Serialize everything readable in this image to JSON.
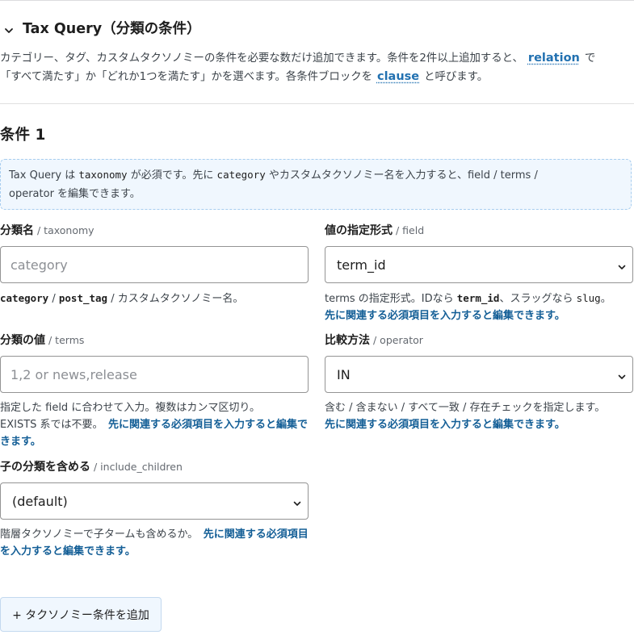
{
  "section": {
    "title": "Tax Query（分類の条件）",
    "intro": {
      "line1_before": "カテゴリー、タグ、カスタムタクソノミーの条件を必要な数だけ追加できます。条件を2件以上追加すると、",
      "relation_link": "relation",
      "line1_after": "で",
      "line2_before": "「すべて満たす」か「どれか1つを満たす」かを選べます。各条件ブロックを",
      "clause_link": "clause",
      "line2_after": "と呼びます。"
    }
  },
  "clause": {
    "title": "条件 1",
    "notice": {
      "p1": "Tax Query は ",
      "code": "taxonomy",
      "p2": " が必須です。先に ",
      "code2": "category",
      "p3": " やカスタムタクソノミー名を入力すると、field / terms /",
      "p4": "operator を編集できます。"
    },
    "fields": {
      "taxonomy": {
        "label": "分類名",
        "sub": "/ taxonomy",
        "placeholder": "category",
        "help_c1": "category",
        "help_s1": " / ",
        "help_c2": "post_tag",
        "help_t": " / カスタムタクソノミー名。"
      },
      "field": {
        "label": "値の指定形式",
        "sub": "/ field",
        "selected": "term_id",
        "help_t1": "terms の指定形式。IDなら ",
        "help_c1": "term_id",
        "help_t2": "、スラッグなら ",
        "help_c2": "slug",
        "help_t3": "。",
        "help_req": "先に関連する必須項目を入力すると編集できます。"
      },
      "terms": {
        "label": "分類の値",
        "sub": "/ terms",
        "placeholder": "1,2 or news,release",
        "help_line1": "指定した field に合わせて入力。複数はカンマ区切り。",
        "help_line2": "EXISTS 系では不要。",
        "help_req": "先に関連する必須項目を入力すると編集できます。"
      },
      "operator": {
        "label": "比較方法",
        "sub": "/ operator",
        "selected": "IN",
        "help": "含む / 含まない / すべて一致 / 存在チェックを指定します。",
        "help_req": "先に関連する必須項目を入力すると編集できます。"
      },
      "include_children": {
        "label": "子の分類を含める",
        "sub": "/ include_children",
        "selected": "(default)",
        "help": "階層タクソノミーで子タームも含めるか。",
        "help_req": "先に関連する必須項目を入力すると編集できます。"
      }
    }
  },
  "add_button": {
    "label": "+ タクソノミー条件を追加"
  },
  "colors": {
    "link": "#2271b1",
    "required_note": "#135e96",
    "notice_bg": "#f0f7fe",
    "notice_border": "#a7cdef",
    "text": "#1e1e1e",
    "muted": "#3c434a"
  },
  "icons": {
    "header_toggle": "chevron-down-icon",
    "select_caret": "chevron-down-icon"
  }
}
